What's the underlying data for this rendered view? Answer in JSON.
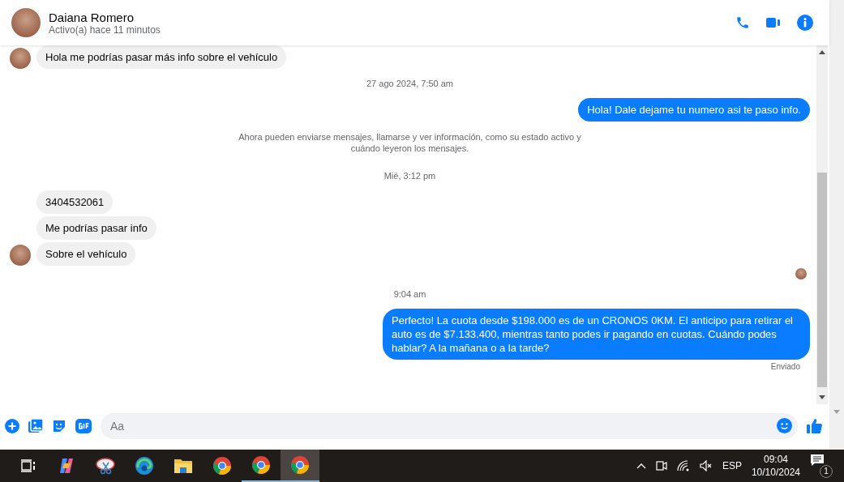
{
  "header": {
    "name": "Daiana Romero",
    "status": "Activo(a) hace 11 minutos"
  },
  "messages": [
    {
      "kind": "incoming",
      "text": "Hola me podrías pasar más info sobre el vehículo",
      "avatar": true
    },
    {
      "kind": "timestamp",
      "text": "27 ago 2024, 7:50 am"
    },
    {
      "kind": "outgoing",
      "text": "Hola! Dale dejame tu numero  asi te paso info."
    },
    {
      "kind": "notice",
      "text": "Ahora pueden enviarse mensajes, llamarse y ver información, como su estado activo y cuándo leyeron los mensajes."
    },
    {
      "kind": "timestamp",
      "text": "Mié, 3:12 pm"
    },
    {
      "kind": "incoming",
      "text": "3404532061",
      "avatar": false
    },
    {
      "kind": "incoming",
      "text": "Me podrías pasar info",
      "avatar": false
    },
    {
      "kind": "incoming",
      "text": "Sobre el vehículo",
      "avatar": true
    },
    {
      "kind": "seen"
    },
    {
      "kind": "timestamp",
      "text": "9:04 am"
    },
    {
      "kind": "outgoing",
      "text": "Perfecto! La cuota desde $198.000 es de un CRONOS 0KM. El anticipo para retirar el auto es de $7.133.400, mientras tanto podes ir pagando en cuotas. Cuándo podes hablar? A la mañana o a la tarde?"
    },
    {
      "kind": "status",
      "text": "Enviado"
    }
  ],
  "composer": {
    "placeholder": "Aa"
  },
  "taskbar": {
    "apps": [
      {
        "kind": "copilot",
        "selected": false,
        "running": false
      },
      {
        "kind": "snip",
        "selected": false,
        "running": false
      },
      {
        "kind": "edge",
        "selected": false,
        "running": false
      },
      {
        "kind": "folder",
        "selected": false,
        "running": false
      },
      {
        "kind": "chrome",
        "selected": false,
        "running": false
      },
      {
        "kind": "chrome",
        "selected": false,
        "running": true
      },
      {
        "kind": "chrome",
        "selected": true,
        "running": true
      }
    ],
    "language": "ESP",
    "time": "09:04",
    "date": "10/10/2024",
    "notifications": "1"
  }
}
